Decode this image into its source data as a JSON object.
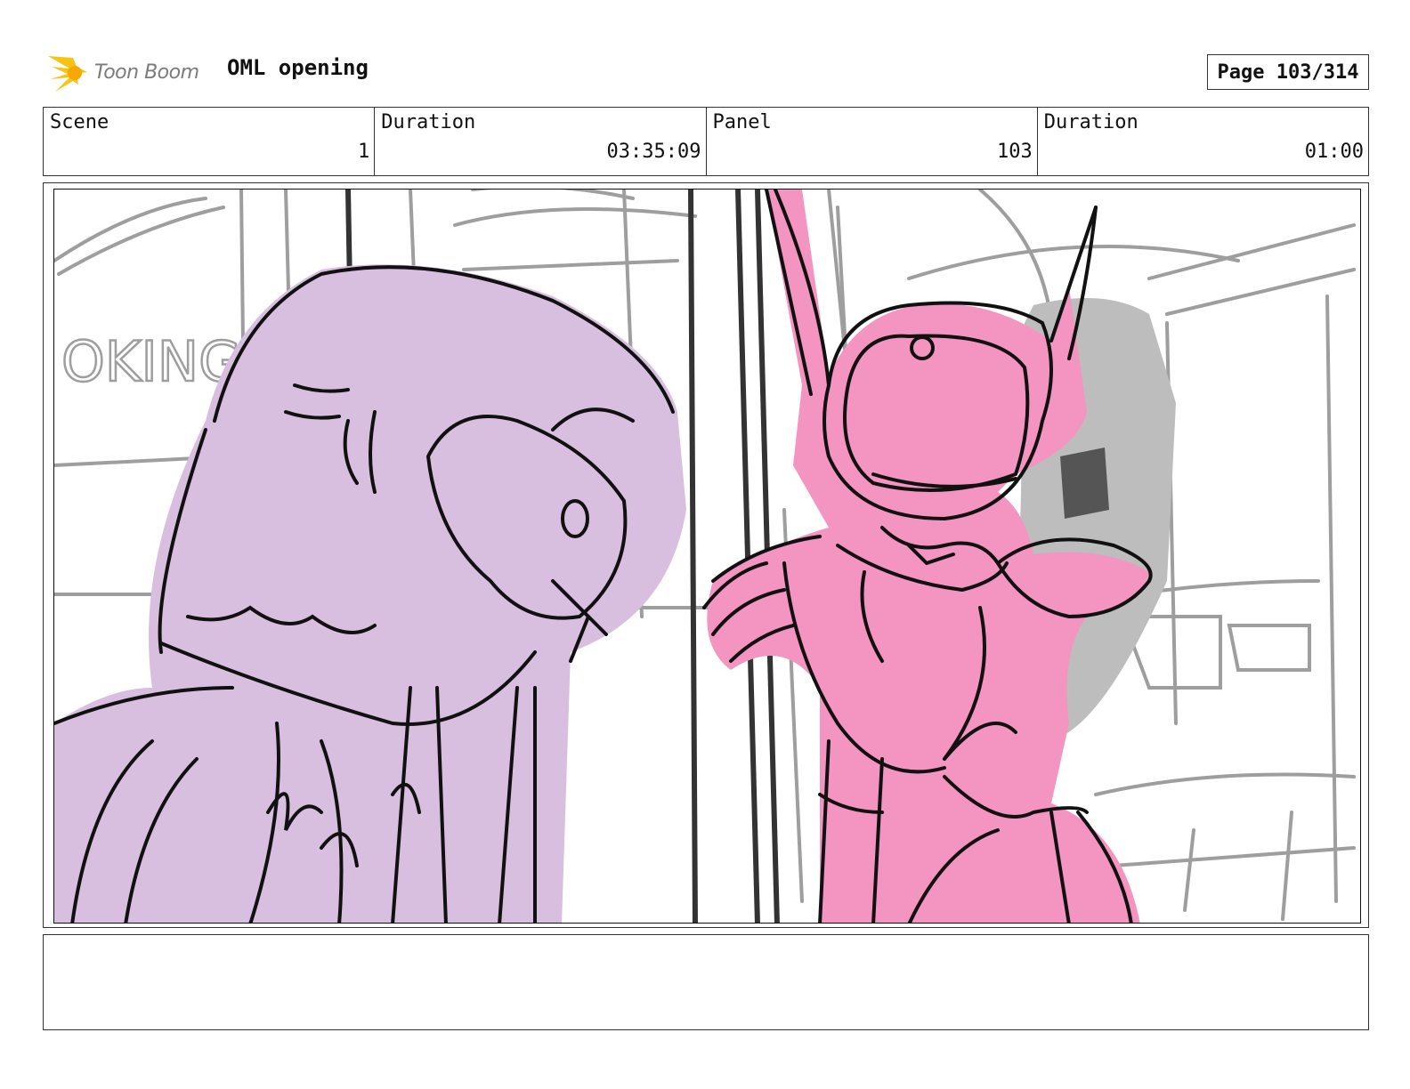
{
  "header": {
    "logo_text": "Toon Boom",
    "project_title": "OML opening",
    "page_label": "Page 103/314"
  },
  "info": {
    "scene_label": "Scene",
    "scene_value": "1",
    "duration_label": "Duration",
    "duration_value": "03:35:09",
    "panel_label": "Panel",
    "panel_value": "103",
    "panel_duration_label": "Duration",
    "panel_duration_value": "01:00"
  },
  "sketch": {
    "background_sign_text": "OKING",
    "colors": {
      "left_character": "#d9bfdf",
      "right_character": "#f494c0",
      "background_lines": "#9a9a9a",
      "ink": "#111111"
    }
  },
  "notes": {
    "text": ""
  }
}
